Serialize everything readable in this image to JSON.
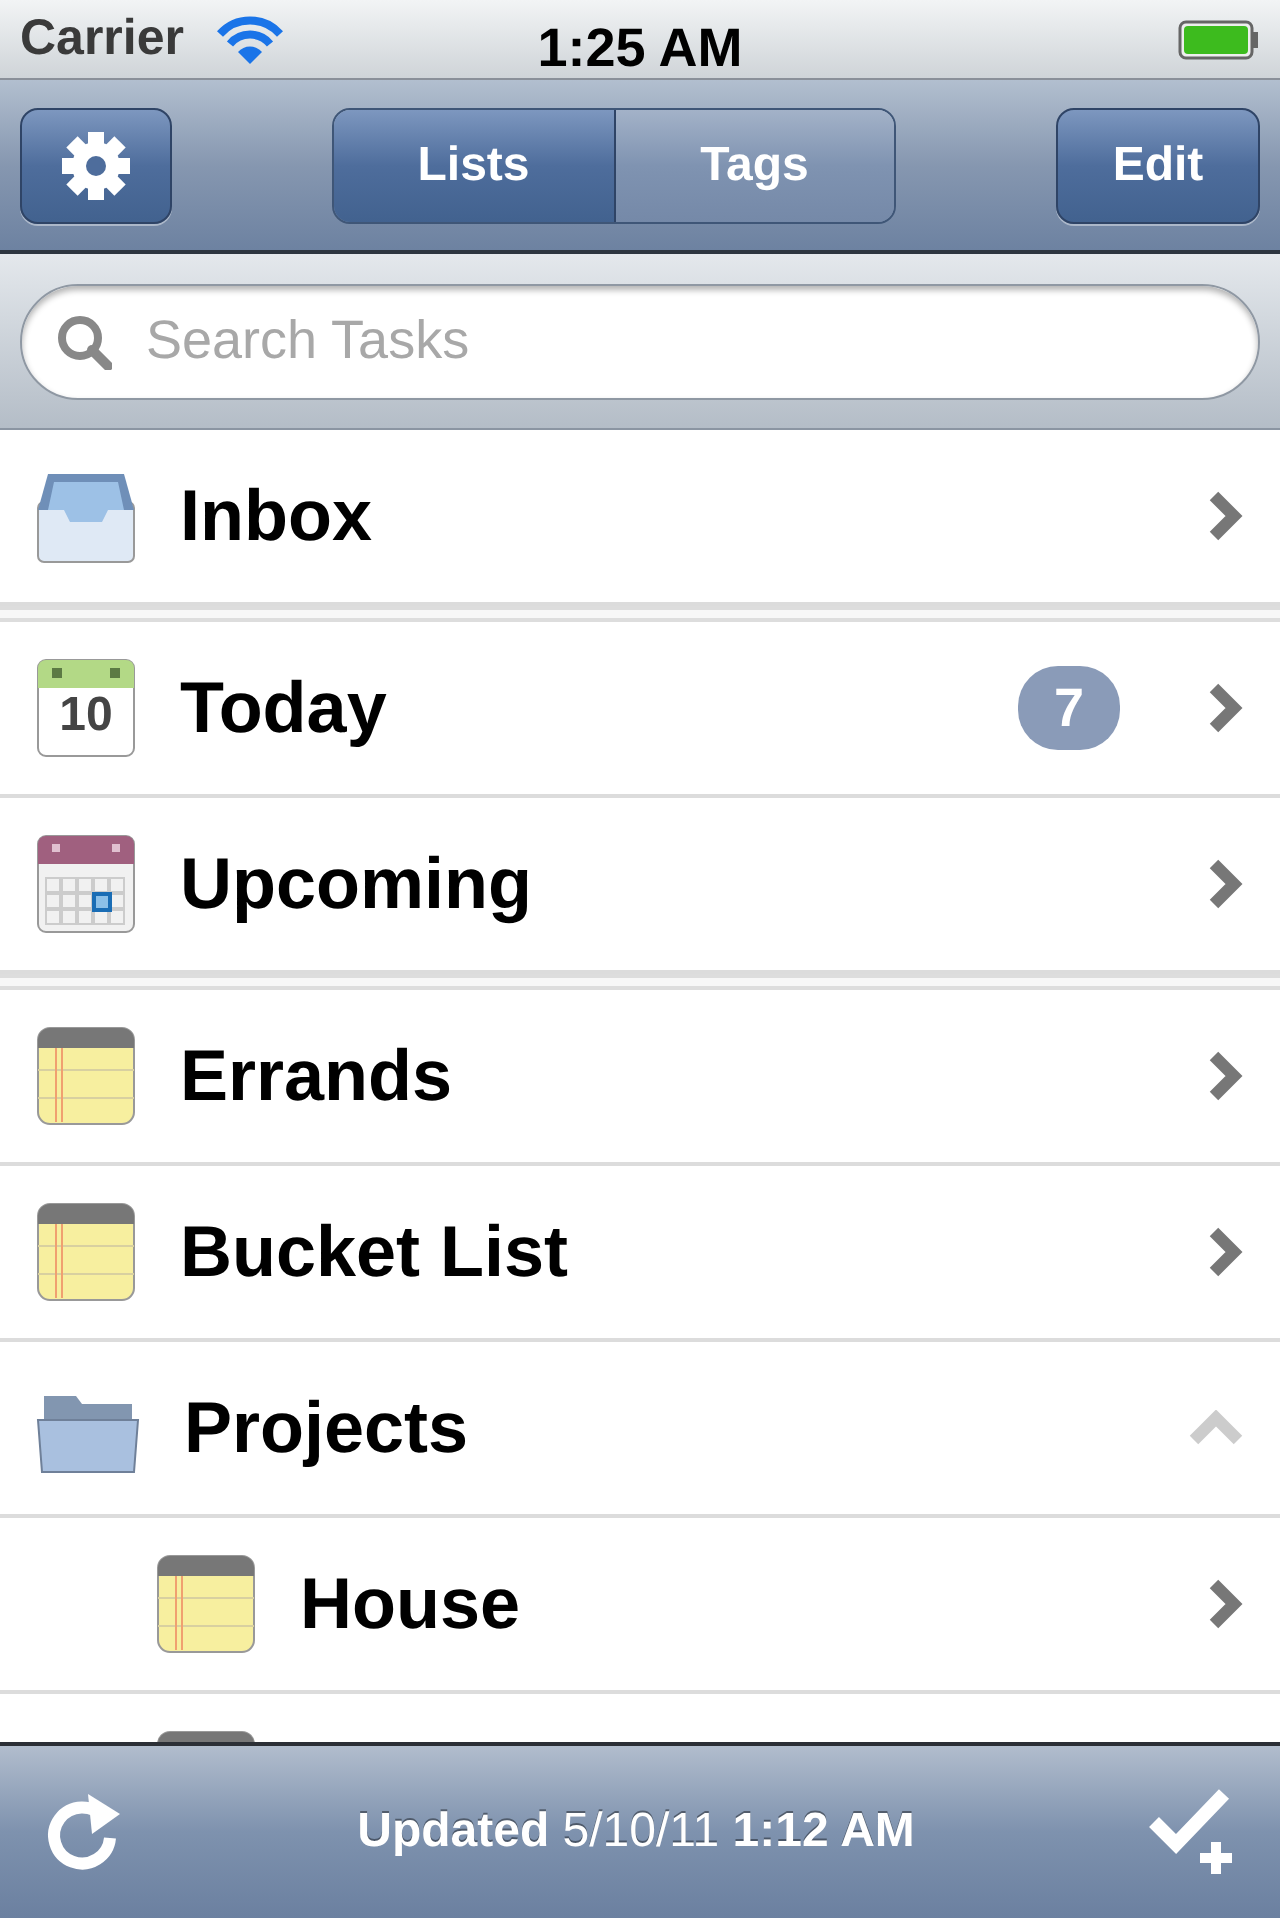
{
  "status_bar": {
    "carrier": "Carrier",
    "time": "1:25 AM"
  },
  "nav_bar": {
    "segments": [
      {
        "label": "Lists",
        "selected": true
      },
      {
        "label": "Tags",
        "selected": false
      }
    ],
    "edit_button": "Edit"
  },
  "search": {
    "placeholder": "Search Tasks"
  },
  "sections": [
    [
      {
        "kind": "inbox",
        "label": "Inbox"
      }
    ],
    [
      {
        "kind": "today",
        "icon_text": "10",
        "label": "Today",
        "badge": "7"
      },
      {
        "kind": "upcoming",
        "label": "Upcoming"
      }
    ],
    [
      {
        "kind": "list",
        "label": "Errands"
      },
      {
        "kind": "list",
        "label": "Bucket List"
      },
      {
        "kind": "folder",
        "label": "Projects",
        "expanded": true,
        "children": [
          {
            "kind": "list",
            "label": "House"
          },
          {
            "kind": "list"
          }
        ]
      }
    ]
  ],
  "toolbar": {
    "status": "**Updated** 5/10/11 **1:12 AM**"
  }
}
